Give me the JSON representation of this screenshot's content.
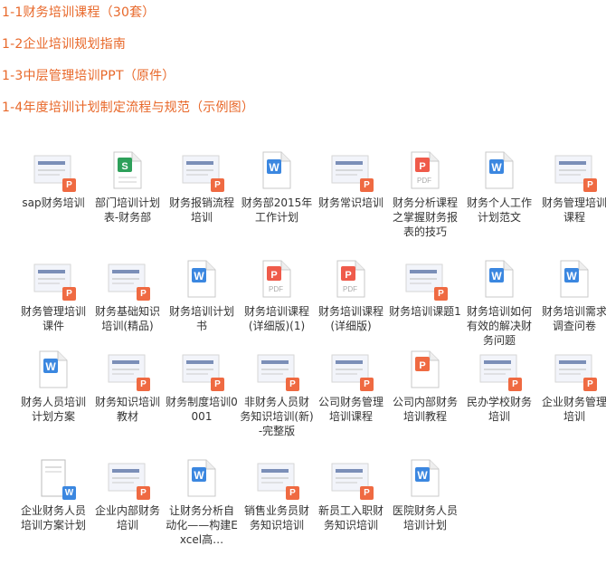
{
  "links": [
    "1-1财务培训课程（30套）",
    "1-2企业培训规划指南",
    "1-3中层管理培训PPT（原件）",
    "1-4年度培训计划制定流程与规范（示例图）"
  ],
  "files": [
    {
      "label": "sap财务培训",
      "icon": "ppt-thumbnail-icon"
    },
    {
      "label": "部门培训计划表-财务部",
      "icon": "excel-file-icon"
    },
    {
      "label": "财务报销流程培训",
      "icon": "ppt-thumbnail-icon"
    },
    {
      "label": "财务部2015年工作计划",
      "icon": "word-file-icon"
    },
    {
      "label": "财务常识培训",
      "icon": "ppt-thumbnail-icon"
    },
    {
      "label": "财务分析课程之掌握财务报表的技巧",
      "icon": "pdf-file-icon"
    },
    {
      "label": "财务个人工作计划范文",
      "icon": "word-file-icon"
    },
    {
      "label": "财务管理培训课程",
      "icon": "ppt-thumbnail-icon"
    },
    {
      "label": "财务管理培训课件",
      "icon": "ppt-thumbnail-icon"
    },
    {
      "label": "财务基础知识培训(精品)",
      "icon": "ppt-thumbnail-icon"
    },
    {
      "label": "财务培训计划书",
      "icon": "word-file-icon"
    },
    {
      "label": "财务培训课程(详细版)(1)",
      "icon": "pdf-file-icon"
    },
    {
      "label": "财务培训课程(详细版)",
      "icon": "pdf-file-icon"
    },
    {
      "label": "财务培训课题1",
      "icon": "ppt-thumbnail-icon"
    },
    {
      "label": "财务培训如何有效的解决财务问题",
      "icon": "word-file-icon"
    },
    {
      "label": "财务培训需求调查问卷",
      "icon": "word-file-icon"
    },
    {
      "label": "财务人员培训计划方案",
      "icon": "word-file-icon"
    },
    {
      "label": "财务知识培训教材",
      "icon": "ppt-thumbnail-icon"
    },
    {
      "label": "财务制度培训0001",
      "icon": "ppt-thumbnail-icon"
    },
    {
      "label": "非财务人员财务知识培训(新)-完整版",
      "icon": "ppt-thumbnail-icon"
    },
    {
      "label": "公司财务管理培训课程",
      "icon": "ppt-thumbnail-icon"
    },
    {
      "label": "公司内部财务培训教程",
      "icon": "ppt-file-icon"
    },
    {
      "label": "民办学校财务培训",
      "icon": "ppt-thumbnail-icon"
    },
    {
      "label": "企业财务管理培训",
      "icon": "ppt-thumbnail-icon"
    },
    {
      "label": "企业财务人员培训方案计划",
      "icon": "word-thumbnail-icon"
    },
    {
      "label": "企业内部财务培训",
      "icon": "ppt-thumbnail-icon"
    },
    {
      "label": "让财务分析自动化——构建Excel高…",
      "icon": "word-file-icon"
    },
    {
      "label": "销售业务员财务知识培训",
      "icon": "ppt-thumbnail-icon"
    },
    {
      "label": "新员工入职财务知识培训",
      "icon": "ppt-thumbnail-icon"
    },
    {
      "label": "医院财务人员培训计划",
      "icon": "word-file-icon"
    }
  ]
}
